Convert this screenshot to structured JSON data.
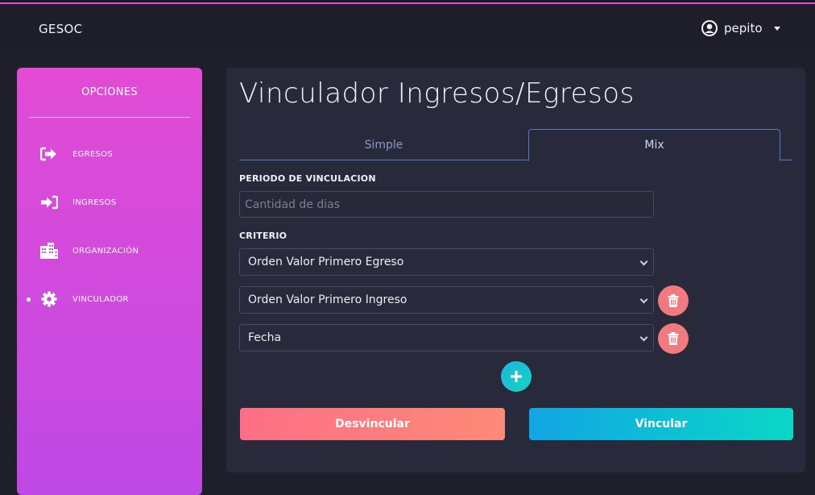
{
  "app": {
    "brand": "GESOC"
  },
  "user": {
    "name": "pepito",
    "icon": "user-circle-icon"
  },
  "sidebar": {
    "title": "OPCIONES",
    "items": [
      {
        "label": "EGRESOS",
        "icon": "sign-out-icon",
        "active": false
      },
      {
        "label": "INGRESOS",
        "icon": "sign-in-icon",
        "active": false
      },
      {
        "label": "ORGANIZACIÓN",
        "icon": "building-icon",
        "active": false
      },
      {
        "label": "VINCULADOR",
        "icon": "gear-icon",
        "active": true
      }
    ]
  },
  "main": {
    "title": "Vinculador Ingresos/Egresos",
    "tabs": [
      {
        "label": "Simple",
        "active": false
      },
      {
        "label": "Mix",
        "active": true
      }
    ],
    "periodo": {
      "label": "PERIODO DE VINCULACION",
      "placeholder": "Cantidad de dias",
      "value": ""
    },
    "criterio": {
      "label": "CRITERIO",
      "selects": [
        {
          "value": "Orden Valor Primero Egreso",
          "deletable": false
        },
        {
          "value": "Orden Valor Primero Ingreso",
          "deletable": true
        },
        {
          "value": "Fecha",
          "deletable": true
        }
      ]
    },
    "buttons": {
      "unlink": "Desvincular",
      "link": "Vincular"
    }
  },
  "colors": {
    "sidebar_gradient": [
      "#e24bd4",
      "#bf49e6"
    ],
    "delete_button": "#f27a7f",
    "add_button": "#18c3d0",
    "unlink_gradient": [
      "#fd6f86",
      "#fd8a77"
    ],
    "link_gradient": [
      "#12a5e3",
      "#0ad7c6"
    ]
  }
}
